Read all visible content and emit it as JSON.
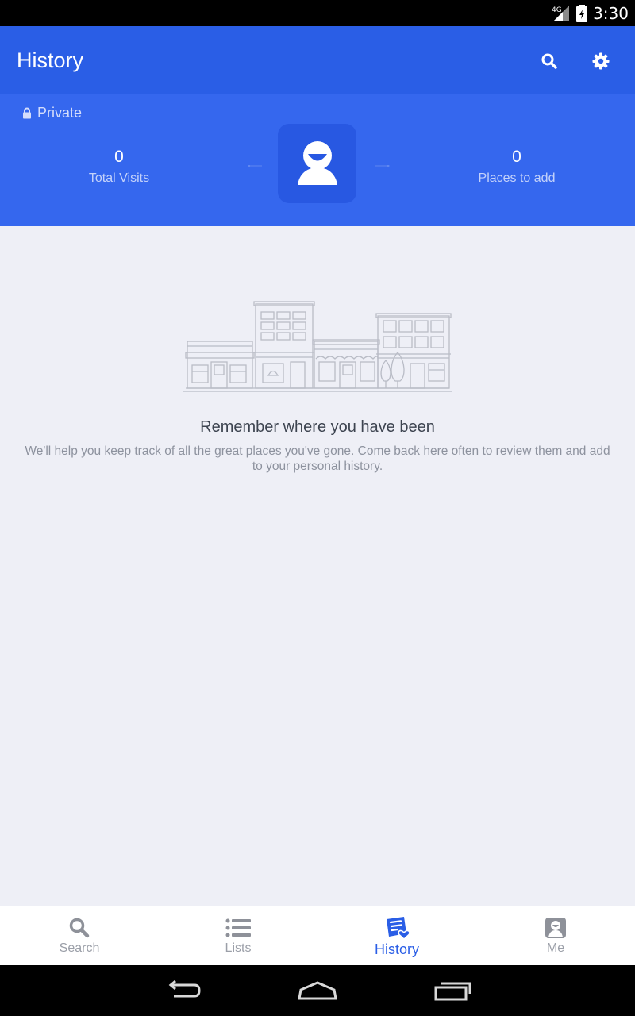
{
  "status_bar": {
    "time": "3:30",
    "network": "4G"
  },
  "app_bar": {
    "title": "History",
    "search_icon": "search-icon",
    "settings_icon": "gear-icon"
  },
  "summary": {
    "privacy_label": "Private",
    "total_visits": {
      "value": "0",
      "label": "Total Visits"
    },
    "places_to_add": {
      "value": "0",
      "label": "Places to add"
    }
  },
  "empty_state": {
    "title": "Remember where you have been",
    "description": "We'll help you keep track of all the great places you've gone. Come back here often to review them and add to your personal history."
  },
  "bottom_nav": {
    "items": [
      {
        "label": "Search",
        "icon": "search-icon"
      },
      {
        "label": "Lists",
        "icon": "list-icon"
      },
      {
        "label": "History",
        "icon": "history-icon",
        "active": true
      },
      {
        "label": "Me",
        "icon": "profile-icon"
      }
    ]
  },
  "colors": {
    "primary": "#2a5ee6",
    "header_secondary": "#3567ee",
    "background": "#eeeff6"
  }
}
